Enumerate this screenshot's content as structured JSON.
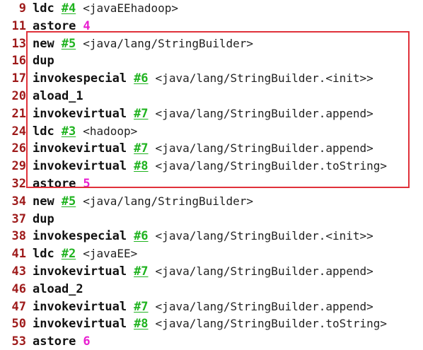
{
  "colors": {
    "offset": "#9e1a1a",
    "opcode": "#111111",
    "constant_ref": "#1fb31f",
    "local_index": "#e81fd0",
    "highlight_border": "#e0313a",
    "background": "#ffffff"
  },
  "lines": [
    {
      "offset": "9",
      "opcode": "ldc",
      "ref": "#4",
      "comment": "<javaEEhadoop>"
    },
    {
      "offset": "11",
      "opcode": "astore",
      "local": "4"
    },
    {
      "offset": "13",
      "opcode": "new",
      "ref": "#5",
      "comment": "<java/lang/StringBuilder>"
    },
    {
      "offset": "16",
      "opcode": "dup"
    },
    {
      "offset": "17",
      "opcode": "invokespecial",
      "ref": "#6",
      "comment": "<java/lang/StringBuilder.<init>>"
    },
    {
      "offset": "20",
      "opcode": "aload_1"
    },
    {
      "offset": "21",
      "opcode": "invokevirtual",
      "ref": "#7",
      "comment": "<java/lang/StringBuilder.append>"
    },
    {
      "offset": "24",
      "opcode": "ldc",
      "ref": "#3",
      "comment": "<hadoop>"
    },
    {
      "offset": "26",
      "opcode": "invokevirtual",
      "ref": "#7",
      "comment": "<java/lang/StringBuilder.append>"
    },
    {
      "offset": "29",
      "opcode": "invokevirtual",
      "ref": "#8",
      "comment": "<java/lang/StringBuilder.toString>"
    },
    {
      "offset": "32",
      "opcode": "astore",
      "local": "5"
    },
    {
      "offset": "34",
      "opcode": "new",
      "ref": "#5",
      "comment": "<java/lang/StringBuilder>"
    },
    {
      "offset": "37",
      "opcode": "dup"
    },
    {
      "offset": "38",
      "opcode": "invokespecial",
      "ref": "#6",
      "comment": "<java/lang/StringBuilder.<init>>"
    },
    {
      "offset": "41",
      "opcode": "ldc",
      "ref": "#2",
      "comment": "<javaEE>"
    },
    {
      "offset": "43",
      "opcode": "invokevirtual",
      "ref": "#7",
      "comment": "<java/lang/StringBuilder.append>"
    },
    {
      "offset": "46",
      "opcode": "aload_2"
    },
    {
      "offset": "47",
      "opcode": "invokevirtual",
      "ref": "#7",
      "comment": "<java/lang/StringBuilder.append>"
    },
    {
      "offset": "50",
      "opcode": "invokevirtual",
      "ref": "#8",
      "comment": "<java/lang/StringBuilder.toString>"
    },
    {
      "offset": "53",
      "opcode": "astore",
      "local": "6"
    }
  ]
}
